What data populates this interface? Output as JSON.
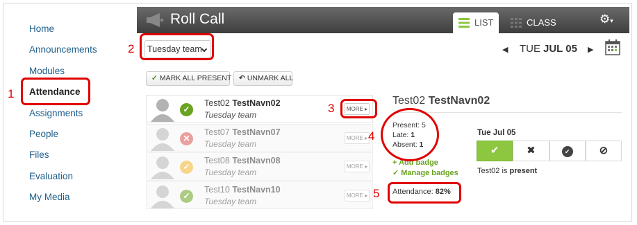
{
  "sidebar": {
    "items": [
      {
        "label": "Home"
      },
      {
        "label": "Announcements"
      },
      {
        "label": "Modules"
      },
      {
        "label": "Attendance"
      },
      {
        "label": "Assignments"
      },
      {
        "label": "People"
      },
      {
        "label": "Files"
      },
      {
        "label": "Evaluation"
      },
      {
        "label": "My Media"
      }
    ]
  },
  "annotations": [
    "1",
    "2",
    "3",
    "4",
    "5"
  ],
  "header": {
    "title": "Roll Call",
    "tabs": [
      {
        "label": "LIST",
        "icon": "list-icon"
      },
      {
        "label": "CLASS",
        "icon": "grid-icon"
      }
    ],
    "settings_icon": "gear-icon"
  },
  "toolbar": {
    "team_select": "Tuesday team",
    "date_prefix": "TUE",
    "date_main": "JUL 05",
    "mark_all_present": "MARK ALL PRESENT",
    "unmark_all": "UNMARK ALL"
  },
  "students": [
    {
      "first": "Test02",
      "last": "TestNavn02",
      "team": "Tuesday team",
      "status": "present",
      "status_color": "#6aa321",
      "more": "MORE ▸"
    },
    {
      "first": "Test07",
      "last": "TestNavn07",
      "team": "Tuesday team",
      "status": "absent",
      "status_color": "#d9534f",
      "more": "MORE ▸"
    },
    {
      "first": "Test08",
      "last": "TestNavn08",
      "team": "Tuesday team",
      "status": "late",
      "status_color": "#f0b429",
      "more": "MORE ▸"
    },
    {
      "first": "Test10",
      "last": "TestNavn10",
      "team": "Tuesday team",
      "status": "present",
      "status_color": "#6aa321",
      "more": "MORE ▸"
    }
  ],
  "detail": {
    "first": "Test02",
    "last": "TestNavn02",
    "present_label": "Present:",
    "present_value": "5",
    "late_label": "Late:",
    "late_value": "1",
    "absent_label": "Absent:",
    "absent_value": "1",
    "add_badge": "+ Add badge",
    "manage_badges": "✓ Manage badges",
    "attendance_label": "Attendance:",
    "attendance_value": "82%",
    "day": "Tue Jul 05",
    "status_prefix": "Test02 is",
    "status_value": "present",
    "buttons": [
      {
        "icon": "checkmark-icon",
        "glyph": "✔"
      },
      {
        "icon": "x-icon",
        "glyph": "✖"
      },
      {
        "icon": "clock-check-icon",
        "glyph": "✔"
      },
      {
        "icon": "excused-icon",
        "glyph": "⊘"
      }
    ]
  },
  "colors": {
    "accent": "#8dc63f",
    "annotation": "#e00000",
    "header": "#4a4a4a"
  }
}
